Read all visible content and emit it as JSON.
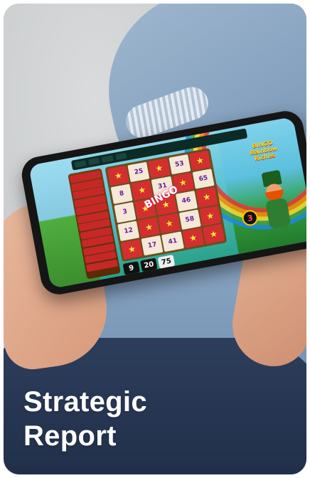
{
  "heading": {
    "line1": "Strategic",
    "line2": "Report"
  },
  "game": {
    "logo_line1": "BINGO",
    "logo_line2": "Rainbow Riches",
    "stamp": "BINGO",
    "grid": [
      "★",
      "25",
      "★",
      "53",
      "★",
      "8",
      "★",
      "31",
      "★",
      "65",
      "3",
      "★",
      "★",
      "46",
      "★",
      "12",
      "★",
      "★",
      "58",
      "★",
      "★",
      "17",
      "41",
      "★",
      "★"
    ],
    "balls": [
      "9",
      "20",
      "75"
    ],
    "counter": "3",
    "pays": [
      "",
      "",
      "",
      "",
      "",
      "",
      "",
      "",
      "",
      "",
      "",
      ""
    ],
    "topbar": [
      "",
      "",
      "",
      ""
    ]
  }
}
